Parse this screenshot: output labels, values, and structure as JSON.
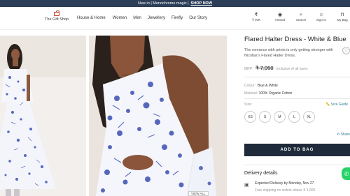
{
  "promo": {
    "text": "New in | Monochrome magic |",
    "cta": "SHOP NOW"
  },
  "header": {
    "logo_text": "The Gift Shop",
    "nav": [
      "House & Home",
      "Women",
      "Men",
      "Jewellery",
      "Firefly",
      "Our Story"
    ],
    "icons": [
      {
        "icon": "currency-icon",
        "label": "₹ INR",
        "glyph": "₹"
      },
      {
        "icon": "eye-icon",
        "label": "Viewed",
        "glyph": "◉"
      },
      {
        "icon": "search-icon",
        "label": "Search",
        "glyph": "⌕"
      },
      {
        "icon": "user-icon",
        "label": "Sign In",
        "glyph": "☺"
      },
      {
        "icon": "bag-icon",
        "label": "My Bag",
        "glyph": "⊓"
      }
    ]
  },
  "product": {
    "title": "Flared Halter Dress - White & Blue",
    "description": "The romance with prints is only getting stronger with Nicobar's Flared Halter Dress.",
    "mrp_label": "MRP:",
    "price": "₹ 7,950",
    "tax_note": "Inclusive of all taxes",
    "colour_label": "Colour :",
    "colour_value": "Blue & White",
    "material_label": "Material:",
    "material_value": "100% Organic Cotton",
    "size_label": "Size:",
    "size_guide": "Size Guide",
    "sizes": [
      "XS",
      "S",
      "M",
      "L",
      "XL"
    ],
    "share": "Share",
    "add_to_bag": "ADD TO BAG",
    "wishlist_glyph": "♡"
  },
  "delivery": {
    "title": "Delivery details",
    "expected": "Expected Delivery by Monday, Nov 27",
    "shipping": "Free shipping on orders above ₹ 1,000"
  },
  "gallery": {
    "badge": "VIEW ALL"
  },
  "colors": {
    "promo_bg": "#2d3e58",
    "button_bg": "#1f2b3a",
    "accent": "#2d7d9a",
    "print_blue": "#3b4fb0",
    "whatsapp": "#25d366"
  }
}
